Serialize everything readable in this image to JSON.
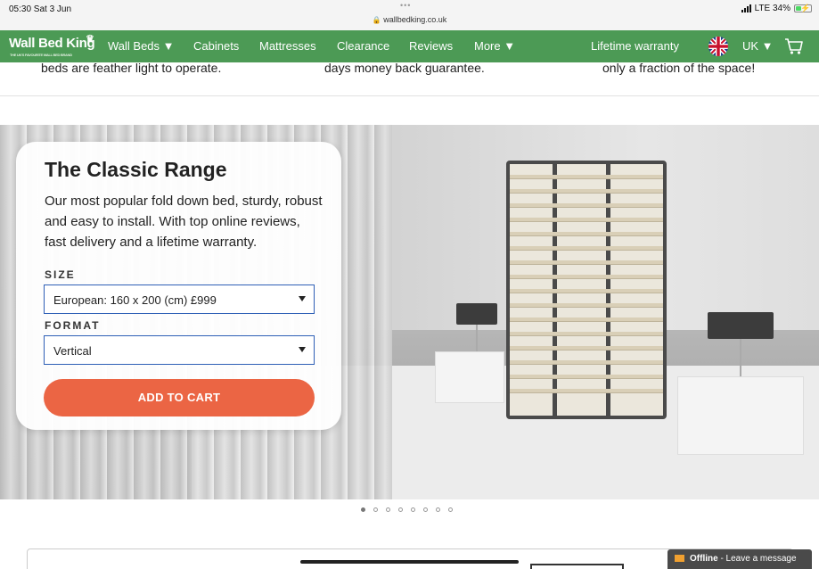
{
  "status_bar": {
    "time": "05:30  Sat 3 Jun",
    "dots": "•••",
    "url": "wallbedking.co.uk",
    "network": "LTE 34%"
  },
  "nav": {
    "logo": "Wall Bed King",
    "items": [
      "Wall Beds ▼",
      "Cabinets",
      "Mattresses",
      "Clearance",
      "Reviews",
      "More ▼"
    ],
    "warranty": "Lifetime warranty",
    "region": "UK ▼"
  },
  "strip": {
    "left": "beds are feather light to operate.",
    "middle": "days money back guarantee.",
    "right": "only a fraction of the space!"
  },
  "product": {
    "title": "The Classic Range",
    "description": "Our most popular fold down bed, sturdy, robust and easy to install. With top online reviews, fast delivery and a lifetime warranty.",
    "size_label": "SIZE",
    "size_value": "European: 160 x 200 (cm) £999",
    "format_label": "FORMAT",
    "format_value": "Vertical",
    "add_to_cart": "ADD TO CART"
  },
  "carousel": {
    "count": 8,
    "active": 0
  },
  "chat": {
    "status": "Offline",
    "message": " - Leave a message"
  }
}
